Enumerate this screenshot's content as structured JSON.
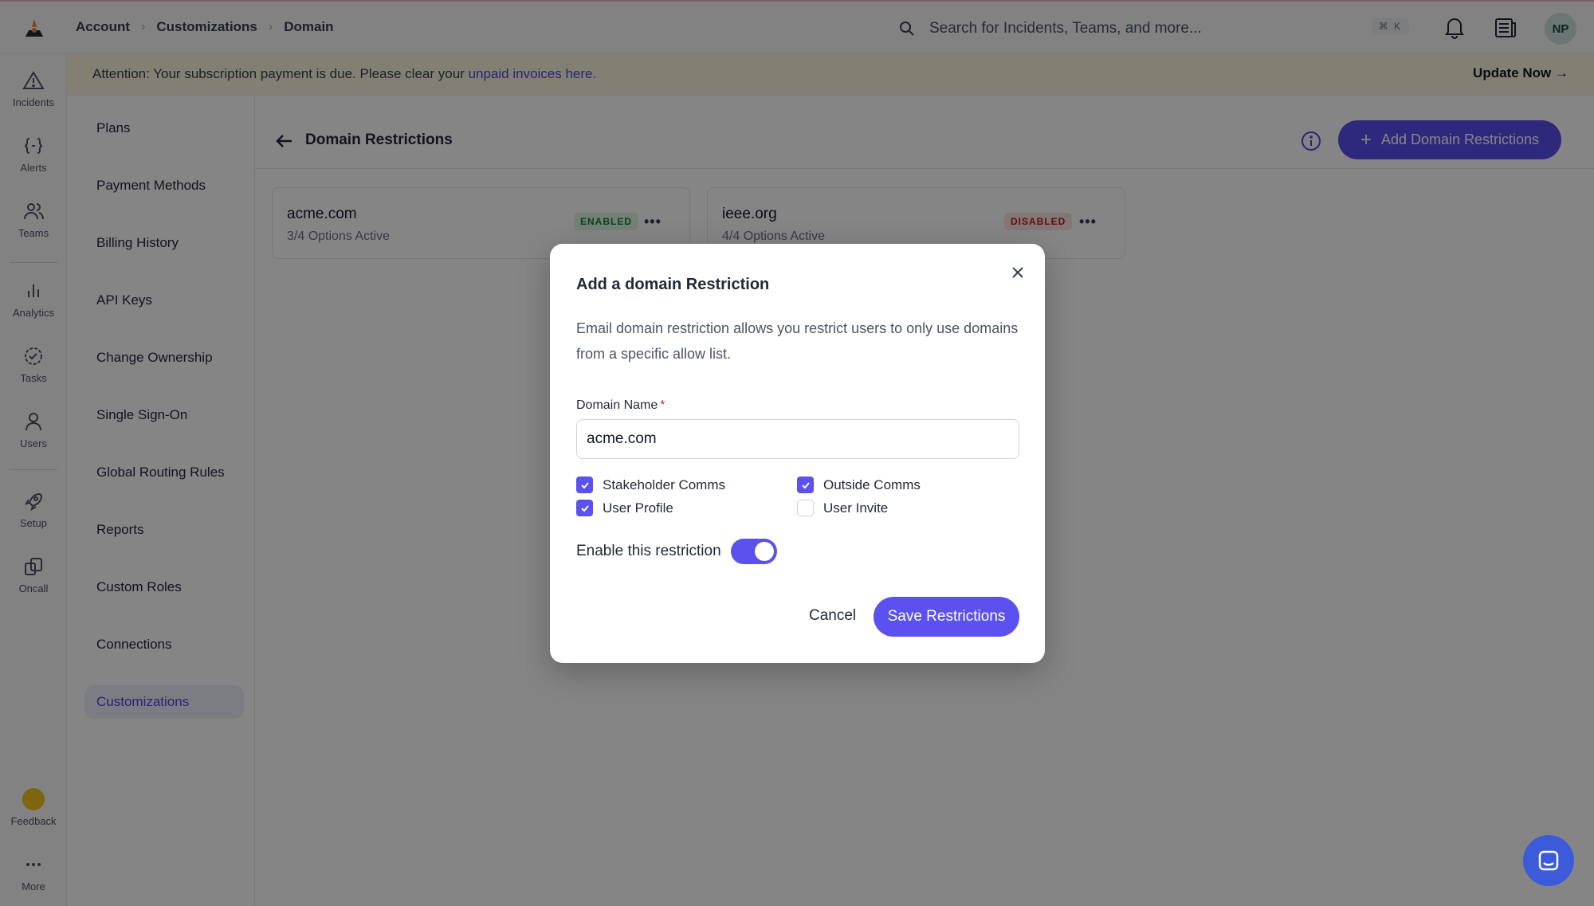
{
  "topbar": {
    "breadcrumb": [
      "Account",
      "Customizations",
      "Domain"
    ],
    "search_placeholder": "Search for Incidents, Teams, and more...",
    "search_shortcut": "⌘ K",
    "avatar_initials": "NP"
  },
  "rail": {
    "items": [
      {
        "label": "Incidents",
        "icon": "alert-triangle-icon"
      },
      {
        "label": "Alerts",
        "icon": "braces-icon"
      },
      {
        "label": "Teams",
        "icon": "users-icon"
      },
      {
        "label": "Analytics",
        "icon": "bar-chart-icon"
      },
      {
        "label": "Tasks",
        "icon": "check-circle-icon"
      },
      {
        "label": "Users",
        "icon": "user-icon"
      },
      {
        "label": "Setup",
        "icon": "rocket-icon"
      },
      {
        "label": "Oncall",
        "icon": "oncall-icon"
      },
      {
        "label": "Feedback",
        "icon": "feedback-icon"
      },
      {
        "label": "More",
        "icon": "more-icon"
      }
    ]
  },
  "banner": {
    "text": "Attention: Your subscription payment is due. Please clear your ",
    "link": "unpaid invoices here.",
    "action": "Update Now →",
    "bg_color": "#fcf3dd"
  },
  "settings_nav": {
    "items": [
      "Plans",
      "Payment Methods",
      "Billing History",
      "API Keys",
      "Change Ownership",
      "Single Sign-On",
      "Global Routing Rules",
      "Reports",
      "Custom Roles",
      "Connections",
      "Customizations"
    ],
    "active": "Customizations"
  },
  "main": {
    "title": "Domain Restrictions",
    "add_button": "Add Domain Restrictions",
    "cards": [
      {
        "domain": "acme.com",
        "options": "3/4 Options Active",
        "status": "ENABLED"
      },
      {
        "domain": "ieee.org",
        "options": "4/4 Options Active",
        "status": "DISABLED"
      }
    ]
  },
  "modal": {
    "title": "Add a domain Restriction",
    "description": "Email domain restriction allows you restrict users to only use domains from a specific allow list.",
    "field_label": "Domain Name",
    "field_required": "*",
    "field_value": "acme.com",
    "options": [
      {
        "label": "Stakeholder Comms",
        "checked": true
      },
      {
        "label": "Outside Comms",
        "checked": true
      },
      {
        "label": "User Profile",
        "checked": true
      },
      {
        "label": "User Invite",
        "checked": false
      }
    ],
    "toggle_label": "Enable this restriction",
    "toggle_on": true,
    "cancel_label": "Cancel",
    "save_label": "Save Restrictions"
  },
  "colors": {
    "accent": "#5b50f0",
    "enabled": "#15803d",
    "disabled": "#b91c1c"
  }
}
